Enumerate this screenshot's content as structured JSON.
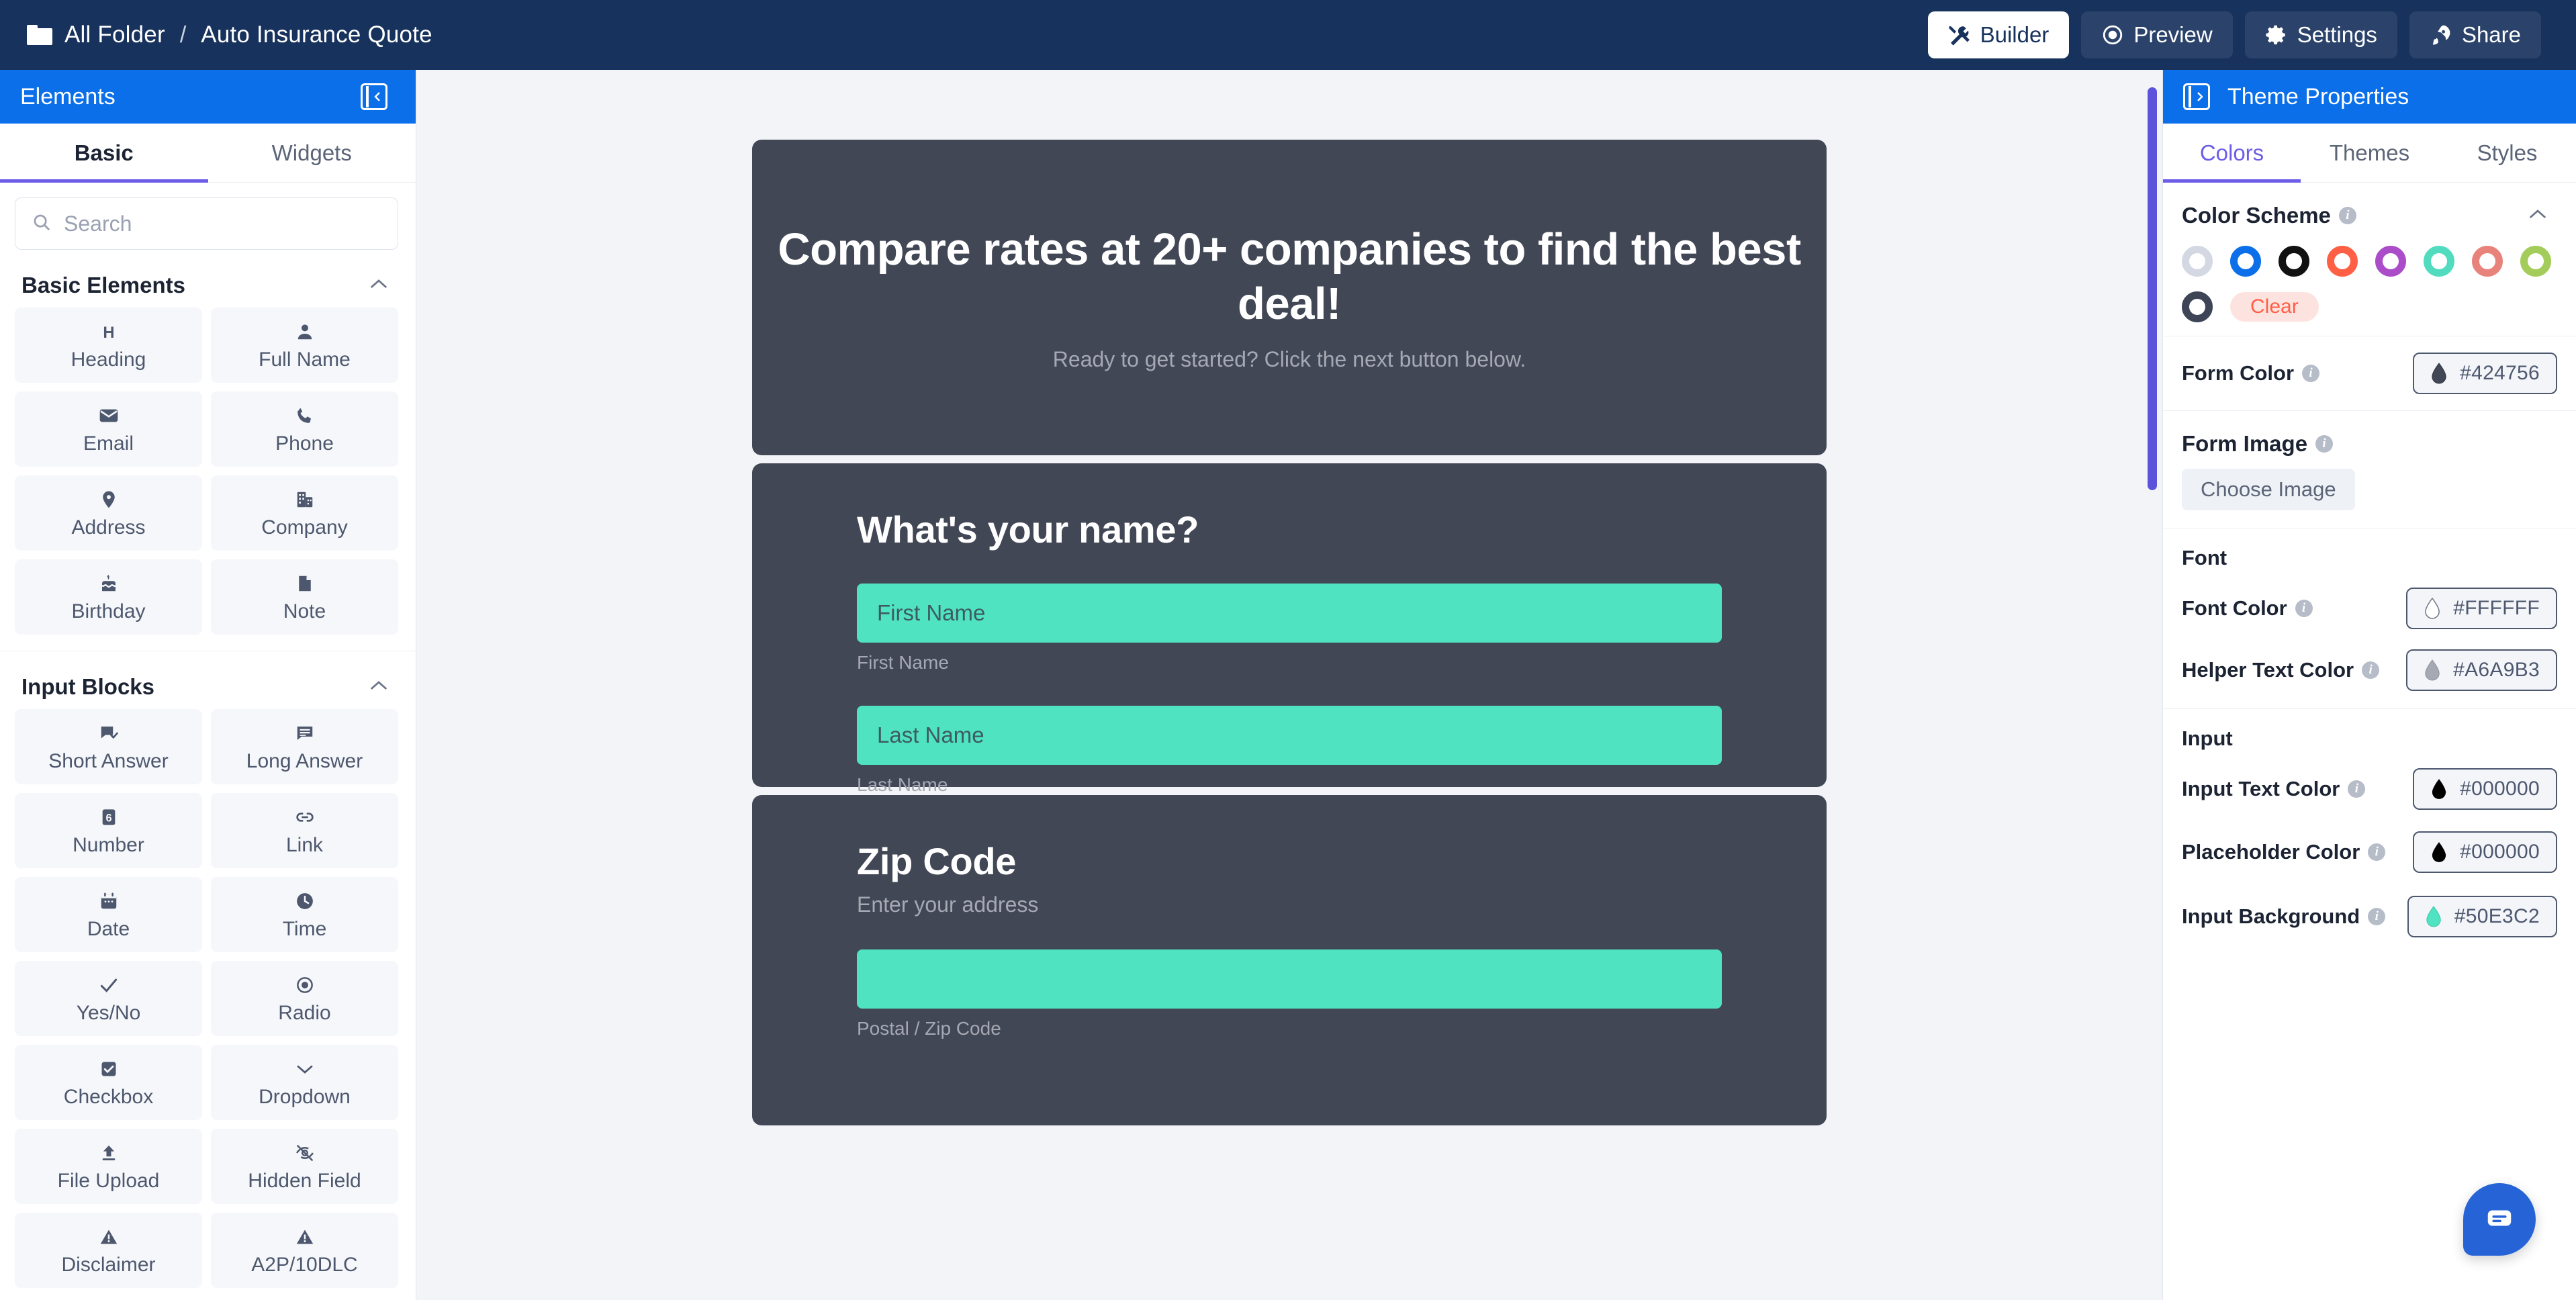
{
  "topbar": {
    "breadcrumb_root": "All Folder",
    "breadcrumb_sep": "/",
    "breadcrumb_current": "Auto Insurance Quote",
    "buttons": [
      {
        "label": "Builder",
        "icon": "tools-icon",
        "active": true
      },
      {
        "label": "Preview",
        "icon": "eye-icon",
        "active": false
      },
      {
        "label": "Settings",
        "icon": "gear-icon",
        "active": false
      },
      {
        "label": "Share",
        "icon": "rocket-icon",
        "active": false
      }
    ]
  },
  "sidebar": {
    "title": "Elements",
    "collapse_icon": "panel-collapse-left-icon",
    "tabs": [
      {
        "label": "Basic",
        "active": true
      },
      {
        "label": "Widgets",
        "active": false
      }
    ],
    "search": {
      "placeholder": "Search",
      "value": "",
      "icon": "search-icon"
    },
    "sections": [
      {
        "title": "Basic Elements",
        "collapse_icon": "chevron-up-icon",
        "items": [
          {
            "label": "Heading",
            "icon": "heading-h-icon"
          },
          {
            "label": "Full Name",
            "icon": "person-icon"
          },
          {
            "label": "Email",
            "icon": "envelope-icon"
          },
          {
            "label": "Phone",
            "icon": "phone-icon"
          },
          {
            "label": "Address",
            "icon": "map-pin-icon"
          },
          {
            "label": "Company",
            "icon": "building-icon"
          },
          {
            "label": "Birthday",
            "icon": "cake-icon"
          },
          {
            "label": "Note",
            "icon": "document-icon"
          }
        ]
      },
      {
        "title": "Input Blocks",
        "collapse_icon": "chevron-up-icon",
        "items": [
          {
            "label": "Short Answer",
            "icon": "speech-bubble-check-icon"
          },
          {
            "label": "Long Answer",
            "icon": "speech-bubble-lines-icon"
          },
          {
            "label": "Number",
            "icon": "number-box-icon"
          },
          {
            "label": "Link",
            "icon": "chain-link-icon"
          },
          {
            "label": "Date",
            "icon": "calendar-icon"
          },
          {
            "label": "Time",
            "icon": "clock-icon"
          },
          {
            "label": "Yes/No",
            "icon": "check-icon"
          },
          {
            "label": "Radio",
            "icon": "radio-button-icon"
          },
          {
            "label": "Checkbox",
            "icon": "checkbox-checked-icon"
          },
          {
            "label": "Dropdown",
            "icon": "chevron-down-icon"
          },
          {
            "label": "File Upload",
            "icon": "upload-icon"
          },
          {
            "label": "Hidden Field",
            "icon": "eye-slash-icon"
          },
          {
            "label": "Disclaimer",
            "icon": "warning-triangle-icon"
          },
          {
            "label": "A2P/10DLC",
            "icon": "warning-triangle-icon"
          }
        ]
      }
    ]
  },
  "canvas": {
    "form_color": "#424756",
    "input_background": "#50E3C2",
    "cards": [
      {
        "type": "intro",
        "headline": "Compare rates at 20+ companies to find the best deal!",
        "subline": "Ready to get started? Click the next button below."
      },
      {
        "type": "question",
        "title": "What's your name?",
        "subtitle": "",
        "fields": [
          {
            "placeholder": "First Name",
            "value": "",
            "helper": "First Name"
          },
          {
            "placeholder": "Last Name",
            "value": "",
            "helper": "Last Name"
          }
        ]
      },
      {
        "type": "question",
        "title": "Zip Code",
        "subtitle": "Enter your address",
        "fields": [
          {
            "placeholder": "",
            "value": "",
            "helper": "Postal / Zip Code"
          }
        ]
      }
    ]
  },
  "rightpanel": {
    "title": "Theme Properties",
    "expand_icon": "panel-expand-right-icon",
    "tabs": [
      {
        "label": "Colors",
        "active": true
      },
      {
        "label": "Themes",
        "active": false
      },
      {
        "label": "Styles",
        "active": false
      }
    ],
    "color_scheme": {
      "title": "Color Scheme",
      "info_icon": "info-icon",
      "collapse_icon": "chevron-up-icon",
      "swatches": [
        "#d3d8e3",
        "#0a6fe8",
        "#111111",
        "#ff5f45",
        "#ab4cc8",
        "#52dcbf",
        "#e8837c",
        "#a4cc5a",
        "#3d4557"
      ],
      "clear_label": "Clear"
    },
    "rows": [
      {
        "label": "Form Color",
        "info_icon": "info-icon",
        "value": "#424756",
        "swatch": "#424756"
      },
      {
        "label": "Font Color",
        "info_icon": "info-icon",
        "value": "#FFFFFF",
        "swatch": "#FFFFFF"
      },
      {
        "label": "Helper Text Color",
        "info_icon": "info-icon",
        "value": "#A6A9B3",
        "swatch": "#A6A9B3"
      },
      {
        "label": "Input Text Color",
        "info_icon": "info-icon",
        "value": "#000000",
        "swatch": "#000000"
      },
      {
        "label": "Placeholder Color",
        "info_icon": "info-icon",
        "value": "#000000",
        "swatch": "#000000"
      },
      {
        "label": "Input Background",
        "info_icon": "info-icon",
        "value": "#50E3C2",
        "swatch": "#50E3C2"
      }
    ],
    "form_image": {
      "label": "Form Image",
      "info_icon": "info-icon",
      "button": "Choose Image"
    },
    "font_block_label": "Font",
    "input_block_label": "Input"
  },
  "chat": {
    "icon": "chat-bubble-icon"
  }
}
